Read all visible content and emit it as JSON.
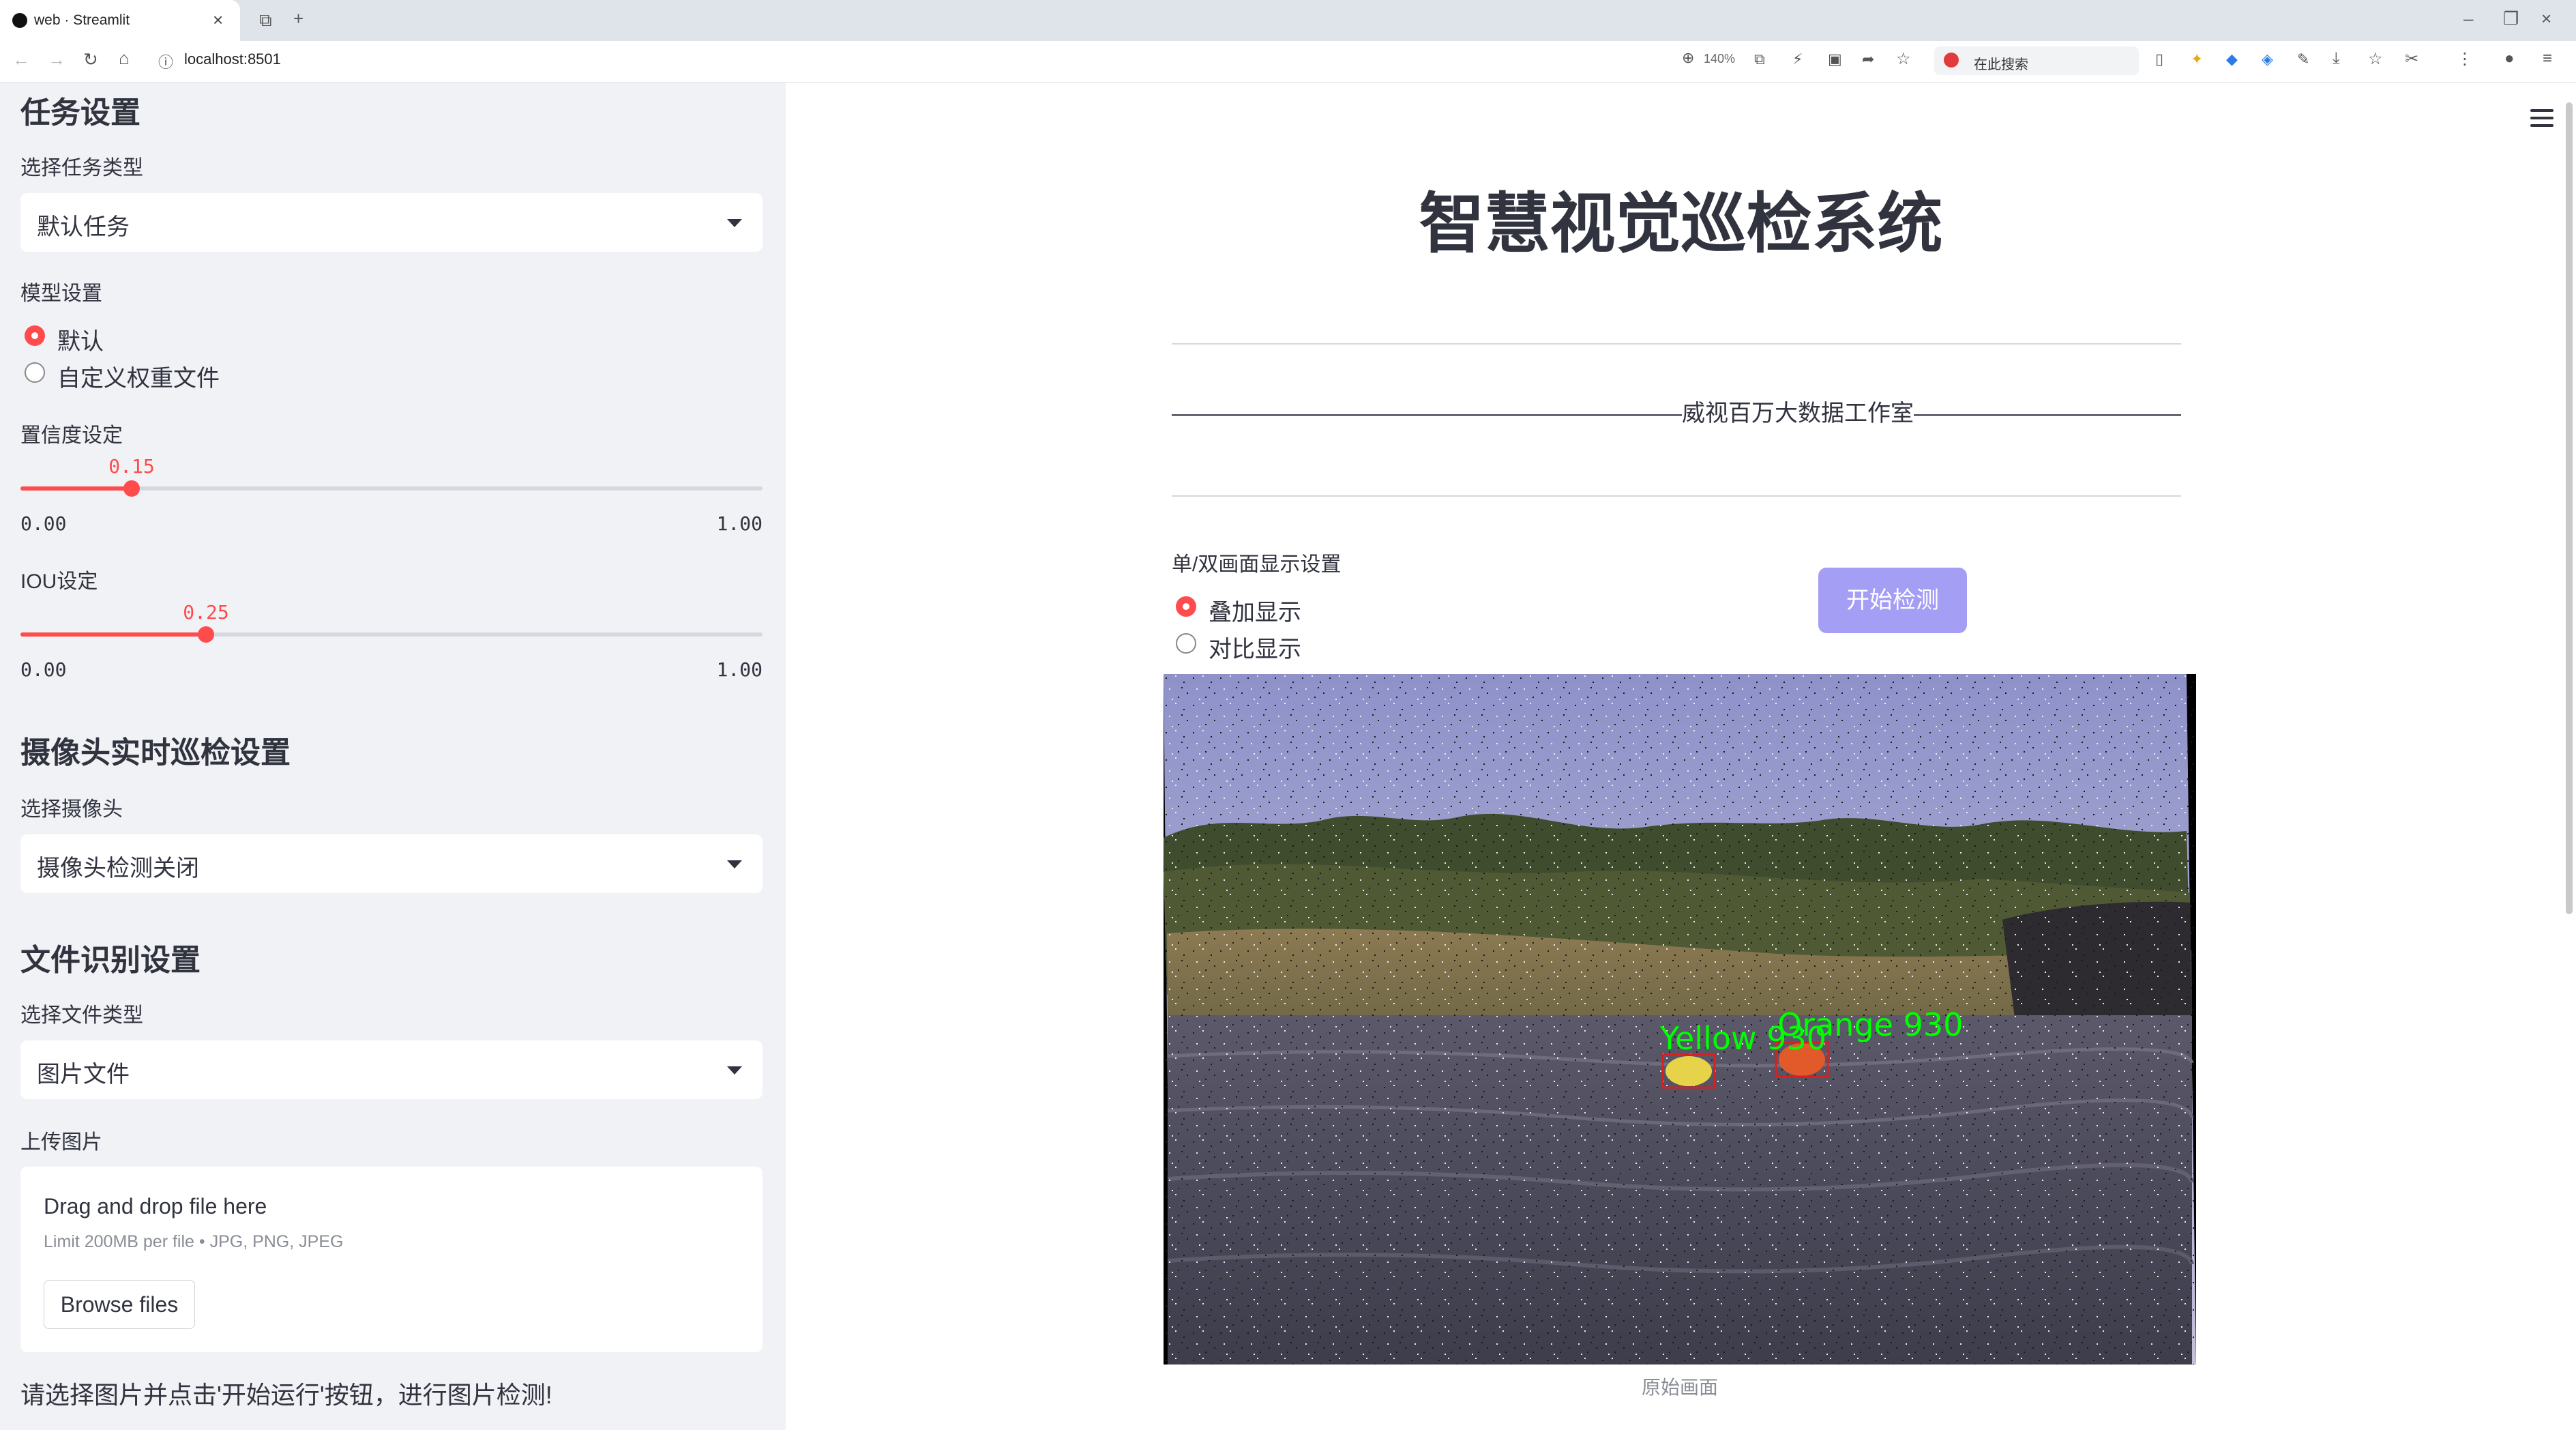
{
  "browser": {
    "tab_title": "web · Streamlit",
    "url": "localhost:8501",
    "zoom": "140%",
    "search_placeholder": "在此搜索"
  },
  "sidebar": {
    "task_section": "任务设置",
    "task_type_label": "选择任务类型",
    "task_type_value": "默认任务",
    "model_label": "模型设置",
    "model_options": [
      "默认",
      "自定义权重文件"
    ],
    "model_selected": "默认",
    "conf_label": "置信度设定",
    "conf": {
      "value": "0.15",
      "min": "0.00",
      "max": "1.00",
      "fraction": 0.15
    },
    "iou_label": "IOU设定",
    "iou": {
      "value": "0.25",
      "min": "0.00",
      "max": "1.00",
      "fraction": 0.25
    },
    "camera_section": "摄像头实时巡检设置",
    "camera_label": "选择摄像头",
    "camera_value": "摄像头检测关闭",
    "file_section": "文件识别设置",
    "file_type_label": "选择文件类型",
    "file_type_value": "图片文件",
    "upload_label": "上传图片",
    "upload_drop_text": "Drag and drop file here",
    "upload_limit": "Limit 200MB per file • JPG, PNG, JPEG",
    "browse_button": "Browse files",
    "hint": "请选择图片并点击'开始运行'按钮，进行图片检测!"
  },
  "main": {
    "title": "智慧视觉巡检系统",
    "subtitle": "——————————————————————威视百万大数据工作室———————————————————————",
    "display_label": "单/双画面显示设置",
    "display_options": [
      "叠加显示",
      "对比显示"
    ],
    "display_selected": "叠加显示",
    "start_button": "开始检测",
    "image_caption": "原始画面",
    "detections": [
      {
        "label": "Yellow 930",
        "color": "#00ff00"
      },
      {
        "label": "Orange 930",
        "color": "#00ff00"
      }
    ]
  },
  "colors": {
    "accent": "#ff4b4b",
    "button": "#a59ef5",
    "sidebar_bg": "#f0f2f6"
  }
}
